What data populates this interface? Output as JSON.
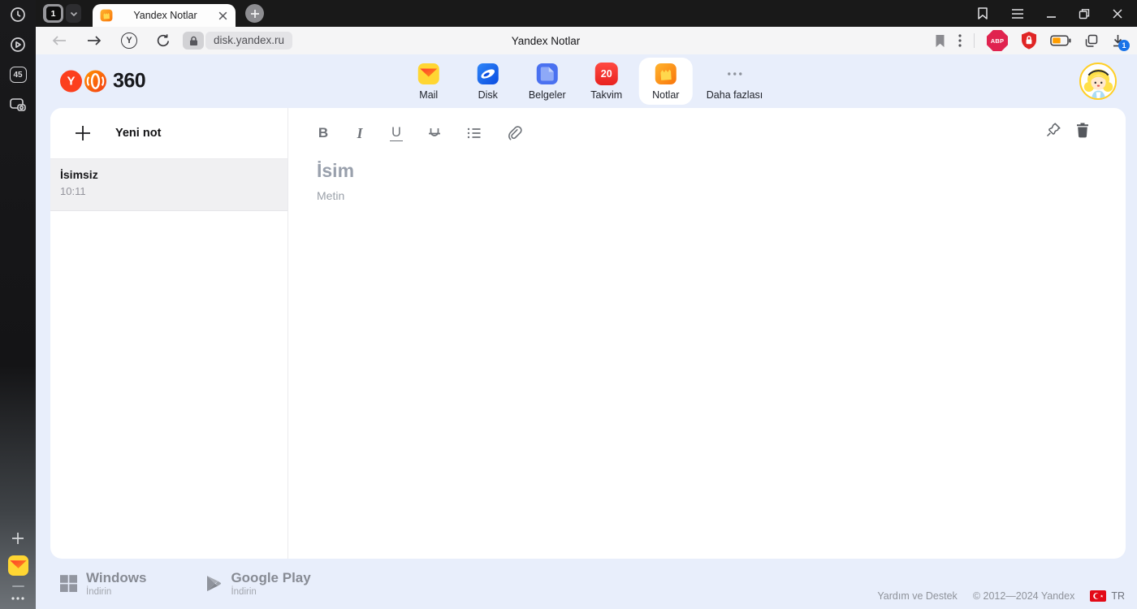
{
  "browser": {
    "sidebar": {
      "tab_count": "45"
    },
    "tab_group_label": "1",
    "active_tab_title": "Yandex Notlar",
    "address": "disk.yandex.ru",
    "centered_page_title": "Yandex Notlar",
    "yandex_button_letter": "Y",
    "adblock_label": "ABP",
    "downloads_badge": "1"
  },
  "header": {
    "logo_letter": "Y",
    "logo_text": "360",
    "apps": [
      {
        "label": "Mail"
      },
      {
        "label": "Disk"
      },
      {
        "label": "Belgeler"
      },
      {
        "label": "Takvim",
        "badge": "20"
      },
      {
        "label": "Notlar"
      },
      {
        "label": "Daha fazlası"
      }
    ]
  },
  "notes": {
    "new_note": "Yeni not",
    "items": [
      {
        "title": "İsimsiz",
        "time": "10:11"
      }
    ]
  },
  "editor": {
    "bold": "B",
    "italic": "I",
    "underline": "U",
    "title_placeholder": "İsim",
    "body_placeholder": "Metin"
  },
  "footer": {
    "windows_title": "Windows",
    "windows_sub": "İndirin",
    "gplay_title": "Google Play",
    "gplay_sub": "İndirin",
    "help": "Yardım ve Destek",
    "copyright": "© 2012—2024 Yandex",
    "lang": "TR"
  },
  "colors": {
    "accent_red": "#fc3f1d",
    "page_bg": "#e8eefb",
    "calendar_red": "#ee2f28",
    "download_badge_blue": "#1a73e8",
    "selected_pill": "#ffffff"
  }
}
